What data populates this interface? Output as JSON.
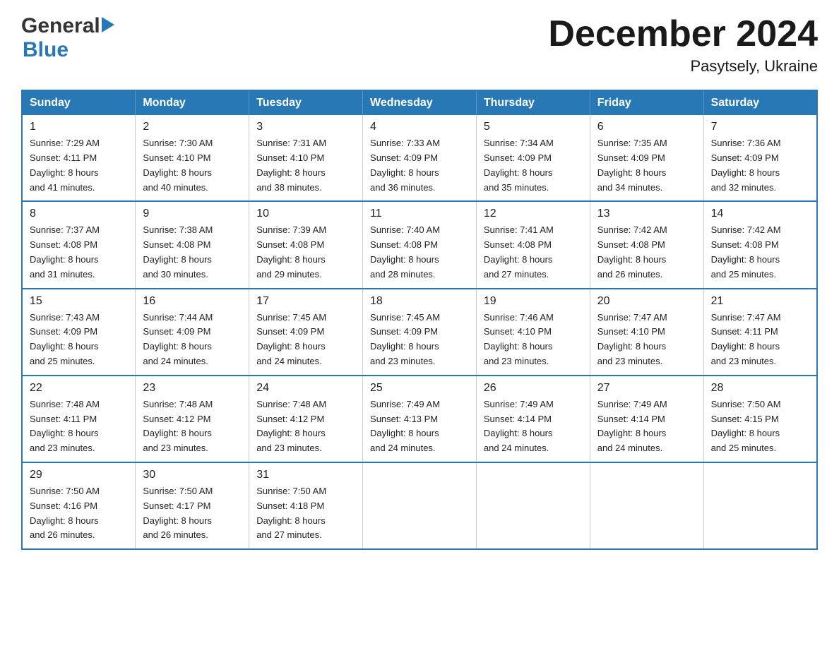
{
  "header": {
    "logo_general": "General",
    "logo_blue": "Blue",
    "title": "December 2024",
    "subtitle": "Pasytsely, Ukraine"
  },
  "calendar": {
    "days_of_week": [
      "Sunday",
      "Monday",
      "Tuesday",
      "Wednesday",
      "Thursday",
      "Friday",
      "Saturday"
    ],
    "weeks": [
      [
        {
          "day": "1",
          "sunrise": "7:29 AM",
          "sunset": "4:11 PM",
          "daylight": "8 hours and 41 minutes."
        },
        {
          "day": "2",
          "sunrise": "7:30 AM",
          "sunset": "4:10 PM",
          "daylight": "8 hours and 40 minutes."
        },
        {
          "day": "3",
          "sunrise": "7:31 AM",
          "sunset": "4:10 PM",
          "daylight": "8 hours and 38 minutes."
        },
        {
          "day": "4",
          "sunrise": "7:33 AM",
          "sunset": "4:09 PM",
          "daylight": "8 hours and 36 minutes."
        },
        {
          "day": "5",
          "sunrise": "7:34 AM",
          "sunset": "4:09 PM",
          "daylight": "8 hours and 35 minutes."
        },
        {
          "day": "6",
          "sunrise": "7:35 AM",
          "sunset": "4:09 PM",
          "daylight": "8 hours and 34 minutes."
        },
        {
          "day": "7",
          "sunrise": "7:36 AM",
          "sunset": "4:09 PM",
          "daylight": "8 hours and 32 minutes."
        }
      ],
      [
        {
          "day": "8",
          "sunrise": "7:37 AM",
          "sunset": "4:08 PM",
          "daylight": "8 hours and 31 minutes."
        },
        {
          "day": "9",
          "sunrise": "7:38 AM",
          "sunset": "4:08 PM",
          "daylight": "8 hours and 30 minutes."
        },
        {
          "day": "10",
          "sunrise": "7:39 AM",
          "sunset": "4:08 PM",
          "daylight": "8 hours and 29 minutes."
        },
        {
          "day": "11",
          "sunrise": "7:40 AM",
          "sunset": "4:08 PM",
          "daylight": "8 hours and 28 minutes."
        },
        {
          "day": "12",
          "sunrise": "7:41 AM",
          "sunset": "4:08 PM",
          "daylight": "8 hours and 27 minutes."
        },
        {
          "day": "13",
          "sunrise": "7:42 AM",
          "sunset": "4:08 PM",
          "daylight": "8 hours and 26 minutes."
        },
        {
          "day": "14",
          "sunrise": "7:42 AM",
          "sunset": "4:08 PM",
          "daylight": "8 hours and 25 minutes."
        }
      ],
      [
        {
          "day": "15",
          "sunrise": "7:43 AM",
          "sunset": "4:09 PM",
          "daylight": "8 hours and 25 minutes."
        },
        {
          "day": "16",
          "sunrise": "7:44 AM",
          "sunset": "4:09 PM",
          "daylight": "8 hours and 24 minutes."
        },
        {
          "day": "17",
          "sunrise": "7:45 AM",
          "sunset": "4:09 PM",
          "daylight": "8 hours and 24 minutes."
        },
        {
          "day": "18",
          "sunrise": "7:45 AM",
          "sunset": "4:09 PM",
          "daylight": "8 hours and 23 minutes."
        },
        {
          "day": "19",
          "sunrise": "7:46 AM",
          "sunset": "4:10 PM",
          "daylight": "8 hours and 23 minutes."
        },
        {
          "day": "20",
          "sunrise": "7:47 AM",
          "sunset": "4:10 PM",
          "daylight": "8 hours and 23 minutes."
        },
        {
          "day": "21",
          "sunrise": "7:47 AM",
          "sunset": "4:11 PM",
          "daylight": "8 hours and 23 minutes."
        }
      ],
      [
        {
          "day": "22",
          "sunrise": "7:48 AM",
          "sunset": "4:11 PM",
          "daylight": "8 hours and 23 minutes."
        },
        {
          "day": "23",
          "sunrise": "7:48 AM",
          "sunset": "4:12 PM",
          "daylight": "8 hours and 23 minutes."
        },
        {
          "day": "24",
          "sunrise": "7:48 AM",
          "sunset": "4:12 PM",
          "daylight": "8 hours and 23 minutes."
        },
        {
          "day": "25",
          "sunrise": "7:49 AM",
          "sunset": "4:13 PM",
          "daylight": "8 hours and 24 minutes."
        },
        {
          "day": "26",
          "sunrise": "7:49 AM",
          "sunset": "4:14 PM",
          "daylight": "8 hours and 24 minutes."
        },
        {
          "day": "27",
          "sunrise": "7:49 AM",
          "sunset": "4:14 PM",
          "daylight": "8 hours and 24 minutes."
        },
        {
          "day": "28",
          "sunrise": "7:50 AM",
          "sunset": "4:15 PM",
          "daylight": "8 hours and 25 minutes."
        }
      ],
      [
        {
          "day": "29",
          "sunrise": "7:50 AM",
          "sunset": "4:16 PM",
          "daylight": "8 hours and 26 minutes."
        },
        {
          "day": "30",
          "sunrise": "7:50 AM",
          "sunset": "4:17 PM",
          "daylight": "8 hours and 26 minutes."
        },
        {
          "day": "31",
          "sunrise": "7:50 AM",
          "sunset": "4:18 PM",
          "daylight": "8 hours and 27 minutes."
        },
        null,
        null,
        null,
        null
      ]
    ],
    "labels": {
      "sunrise": "Sunrise:",
      "sunset": "Sunset:",
      "daylight": "Daylight:"
    }
  }
}
